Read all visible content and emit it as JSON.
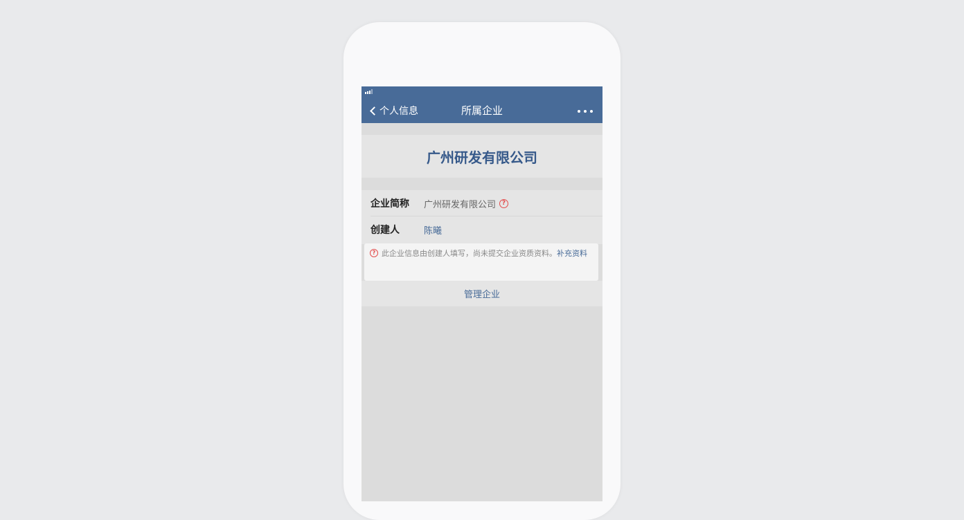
{
  "navbar": {
    "back_label": "个人信息",
    "title": "所属企业"
  },
  "company": {
    "name": "广州研发有限公司"
  },
  "info": {
    "short_name_label": "企业简称",
    "short_name_value": "广州研发有限公司",
    "creator_label": "创建人",
    "creator_value": "陈曦"
  },
  "notice": {
    "text": "此企业信息由创建人填写，尚未提交企业资质资料。",
    "link": "补充资料"
  },
  "actions": {
    "manage_label": "管理企业"
  },
  "icons": {
    "back": "chevron-left-icon",
    "more": "more-dots-icon",
    "help": "question-circle-icon",
    "signal": "signal-icon"
  },
  "colors": {
    "navbar": "#486b98",
    "company_name": "#36598a",
    "link": "#486b98",
    "help": "#e34b4b"
  }
}
